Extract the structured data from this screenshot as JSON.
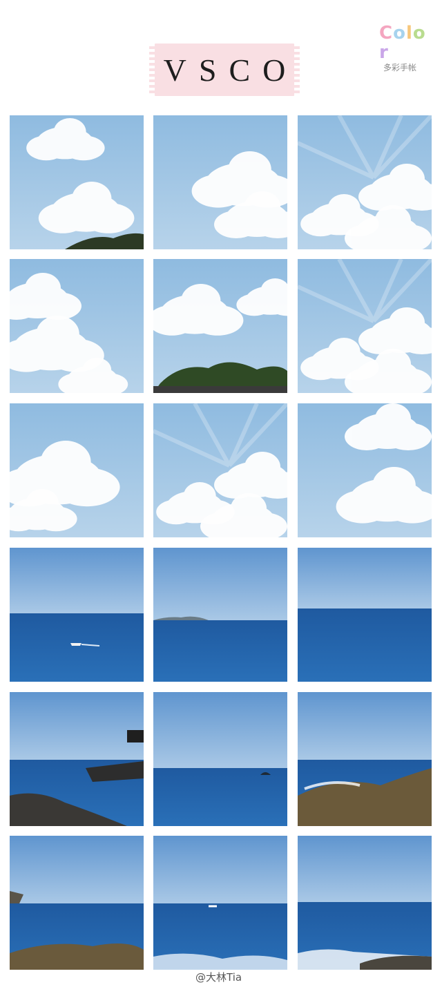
{
  "logo": {
    "word": [
      "C",
      "o",
      "l",
      "o",
      "r"
    ],
    "word_colors": [
      "#f4a6c0",
      "#a7d3ee",
      "#f7c77b",
      "#b9dc8f",
      "#c9a6e8"
    ],
    "subtitle": "多彩手帐"
  },
  "title": "VSCO",
  "photos": [
    {
      "kind": "sky",
      "variant": "clouds-tree-corner"
    },
    {
      "kind": "sky",
      "variant": "clouds-right"
    },
    {
      "kind": "sky",
      "variant": "sunbeam-clouds"
    },
    {
      "kind": "sky",
      "variant": "clouds-left"
    },
    {
      "kind": "sky",
      "variant": "clouds-treeline"
    },
    {
      "kind": "sky",
      "variant": "sunbeam-clouds-2"
    },
    {
      "kind": "sky",
      "variant": "cloud-left-big"
    },
    {
      "kind": "sky",
      "variant": "sunbeam-center"
    },
    {
      "kind": "sky",
      "variant": "clouds-right-2"
    },
    {
      "kind": "sea",
      "variant": "boat"
    },
    {
      "kind": "sea",
      "variant": "island-horizon"
    },
    {
      "kind": "sea",
      "variant": "open-sea"
    },
    {
      "kind": "sea",
      "variant": "pier-rocks"
    },
    {
      "kind": "sea",
      "variant": "rock-islet"
    },
    {
      "kind": "sea",
      "variant": "wave-rocks"
    },
    {
      "kind": "sea",
      "variant": "rocks-left"
    },
    {
      "kind": "sea",
      "variant": "boat-waves"
    },
    {
      "kind": "sea",
      "variant": "waves-rocks-right"
    }
  ],
  "watermark": "@大林Tia"
}
